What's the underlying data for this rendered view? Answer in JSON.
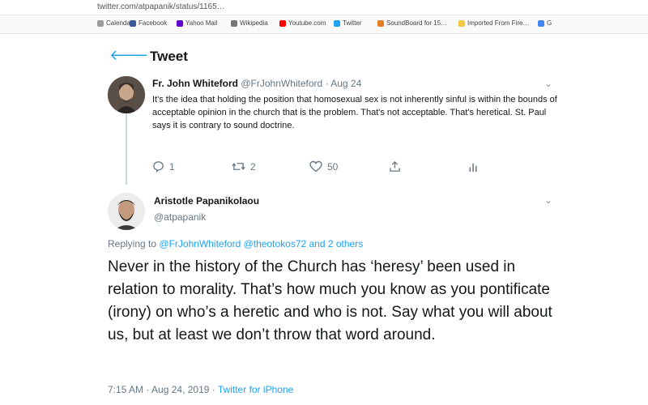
{
  "browser": {
    "url": "twitter.com/atpapanik/status/1165…",
    "bookmarks": [
      {
        "label": "Calendar",
        "color": "#9e9e9e"
      },
      {
        "label": "Facebook",
        "color": "#3b5998"
      },
      {
        "label": "Yahoo Mail",
        "color": "#5f01d1"
      },
      {
        "label": "Wikipedia",
        "color": "#777777"
      },
      {
        "label": "Youtube.com",
        "color": "#ff0000"
      },
      {
        "label": "Twitter",
        "color": "#1da1f2"
      },
      {
        "label": "SoundBoard for 15…",
        "color": "#e67e22"
      },
      {
        "label": "Imported From Fire…",
        "color": "#f4c542"
      },
      {
        "label": "G",
        "color": "#4285f4"
      }
    ]
  },
  "header": {
    "title": "Tweet",
    "back_icon": "back-arrow-icon"
  },
  "tweet1": {
    "name": "Fr. John Whiteford",
    "handle": "@FrJohnWhiteford",
    "date": "· Aug 24",
    "text": "It's the idea that holding the position that homosexual sex is not inherently sinful is within the bounds of acceptable opinion in the church that is the problem. That's not acceptable. That's heretical. St. Paul says it is contrary to sound doctrine.",
    "replies": "1",
    "retweets": "2",
    "likes": "50"
  },
  "tweet2": {
    "name": "Aristotle Papanikolaou",
    "handle": "@atpapanik",
    "replying_prefix": "Replying to",
    "replying_to": "@FrJohnWhiteford @theotokos72 and 2 others",
    "text": "Never in the history of the Church has ‘heresy’ been used in relation to morality.  That’s how much you know as you pontificate (irony) on who’s a heretic and who is not.  Say what you will about us, but at least we don’t throw that word around.",
    "time": "7:15 AM · Aug 24, 2019 ·",
    "source": "Twitter for iPhone"
  },
  "colors": {
    "accent": "#1da1f2",
    "muted": "#657786"
  }
}
